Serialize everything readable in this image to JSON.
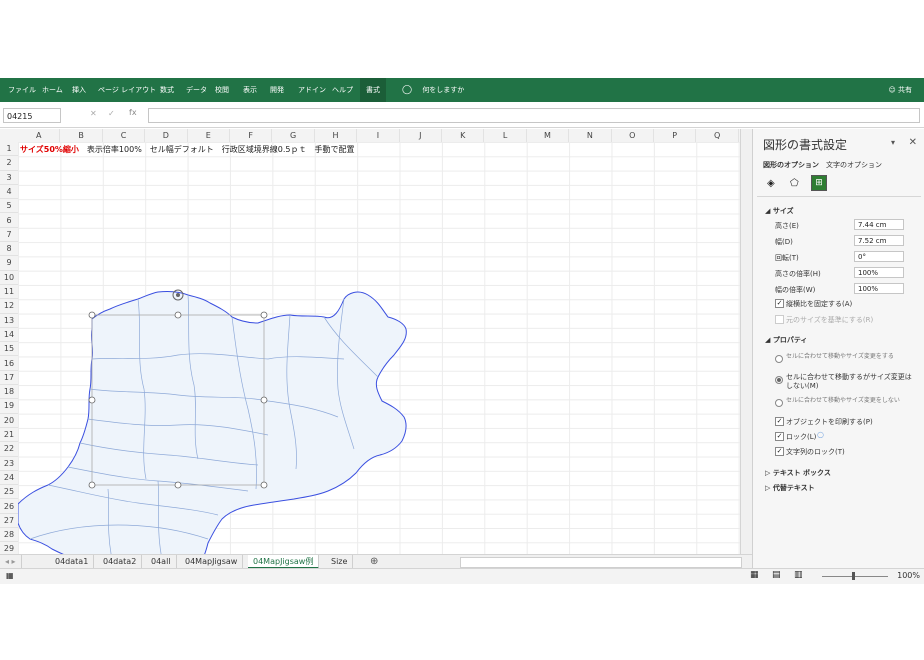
{
  "ribbon": {
    "tabs": [
      "ファイル",
      "ホーム",
      "挿入",
      "ページ レイアウト",
      "数式",
      "データ",
      "校閲",
      "表示",
      "開発",
      "アドイン",
      "ヘルプ",
      "書式"
    ],
    "active_tab": "書式",
    "tell_me": "何をしますか",
    "share": "共有",
    "colors": {
      "ribbon": "#217346",
      "accent": "#217346"
    }
  },
  "formula_bar": {
    "name_box": "04215",
    "fx": "fx",
    "content": ""
  },
  "grid": {
    "columns": [
      "A",
      "B",
      "C",
      "D",
      "E",
      "F",
      "G",
      "H",
      "I",
      "J",
      "K",
      "L",
      "M",
      "N",
      "O",
      "P",
      "Q"
    ],
    "rows": [
      "1",
      "2",
      "3",
      "4",
      "5",
      "6",
      "7",
      "8",
      "9",
      "10",
      "11",
      "12",
      "13",
      "14",
      "15",
      "16",
      "17",
      "18",
      "19",
      "20",
      "21",
      "22",
      "23",
      "24",
      "25",
      "26",
      "27",
      "28",
      "29"
    ],
    "row1": {
      "red_text": "サイズ50%縮小",
      "rest_text": "　表示倍率100%　セル幅デフォルト　行政区域境界線0.5ｐｔ　手動で配置"
    }
  },
  "sheet_tabs": {
    "tabs": [
      "04data1",
      "04data2",
      "04all",
      "04MapJigsaw",
      "04MapJigsaw例",
      "Size"
    ],
    "active": "04MapJigsaw例"
  },
  "status": {
    "zoom": "100%"
  },
  "pane": {
    "title": "図形の書式設定",
    "tab_shape": "図形のオプション",
    "tab_text": "文字のオプション",
    "size_section": "サイズ",
    "height_label": "高さ(E)",
    "height_value": "7.44 cm",
    "width_label": "幅(D)",
    "width_value": "7.52 cm",
    "rotation_label": "回転(T)",
    "rotation_value": "0°",
    "scale_h_label": "高さの倍率(H)",
    "scale_h_value": "100%",
    "scale_w_label": "幅の倍率(W)",
    "scale_w_value": "100%",
    "lock_ratio": "縦横比を固定する(A)",
    "relative_original": "元のサイズを基準にする(R)",
    "properties_section": "プロパティ",
    "prop1": "セルに合わせて移動やサイズ変更をする",
    "prop2": "セルに合わせて移動するがサイズ変更はしない(M)",
    "prop3": "セルに合わせて移動やサイズ変更をしない",
    "print_obj": "オブジェクトを印刷する(P)",
    "lock": "ロック(L)",
    "lock_text": "文字列のロック(T)",
    "textbox_section": "テキスト ボックス",
    "alt_text_section": "代替テキスト"
  }
}
